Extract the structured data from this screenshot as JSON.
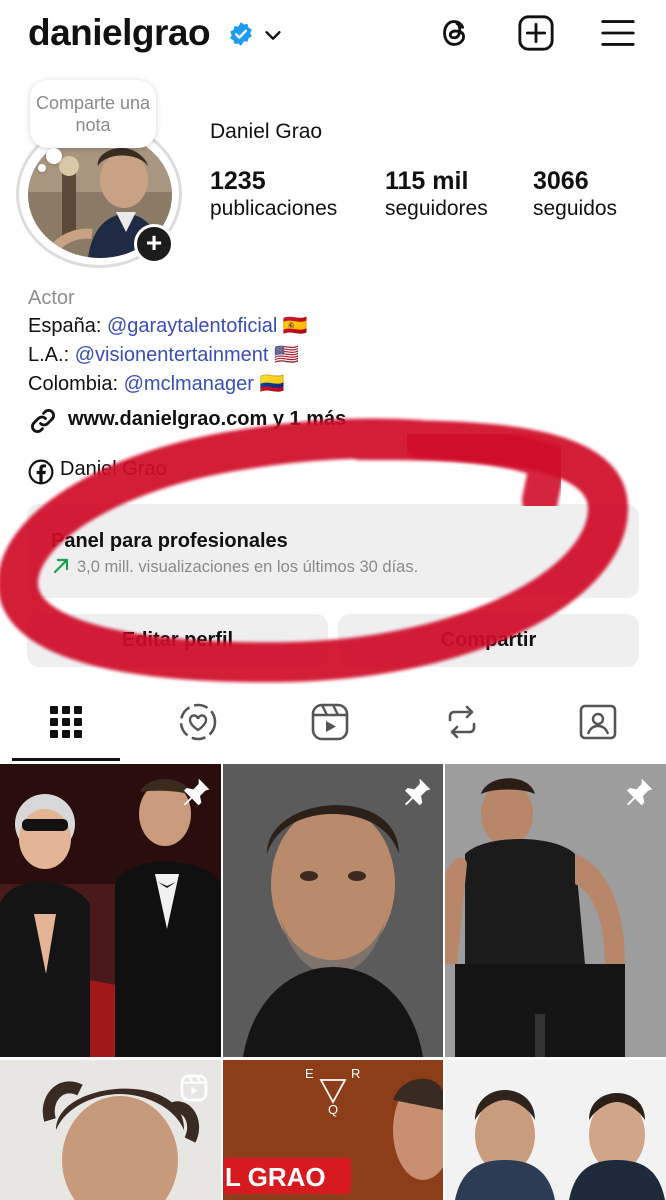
{
  "header": {
    "username": "danielgrao",
    "icons": [
      "verified-badge-icon",
      "chevron-down-icon",
      "threads-icon",
      "new-post-icon",
      "menu-icon"
    ]
  },
  "note": {
    "text": "Comparte una nota"
  },
  "profile": {
    "full_name": "Daniel Grao",
    "stats": [
      {
        "value": "1235",
        "label": "publicaciones"
      },
      {
        "value": "115 mil",
        "label": "seguidores"
      },
      {
        "value": "3066",
        "label": "seguidos"
      }
    ]
  },
  "bio": {
    "category": "Actor",
    "lines": [
      {
        "prefix": "España: ",
        "mention": "@garaytalentoficial",
        "flag": "🇪🇸"
      },
      {
        "prefix": "L.A.: ",
        "mention": "@visionentertainment",
        "flag": "🇺🇸"
      },
      {
        "prefix": "Colombia: ",
        "mention": "@mclmanager",
        "flag": "🇨🇴"
      }
    ],
    "link_text": "www.danielgrao.com y 1 más",
    "facebook_text": "Daniel Grao"
  },
  "panel": {
    "title": "Panel para profesionales",
    "subtitle": "3,0 mill. visualizaciones en los últimos 30 días.",
    "trend_color": "#1f9d55"
  },
  "buttons": {
    "edit": "Editar perfil",
    "share": "Compartir"
  },
  "tabs": [
    "posts-grid-icon",
    "collab-icon",
    "reels-icon",
    "reposts-icon",
    "tagged-icon"
  ],
  "grid": {
    "reel_banner_text": "L GRAO",
    "reel_logo_letters": [
      "E",
      "R",
      "Q"
    ]
  },
  "colors": {
    "accent_mention": "#3a4fb5",
    "verified": "#1d9bf0",
    "annotation_red": "#d0102b"
  }
}
